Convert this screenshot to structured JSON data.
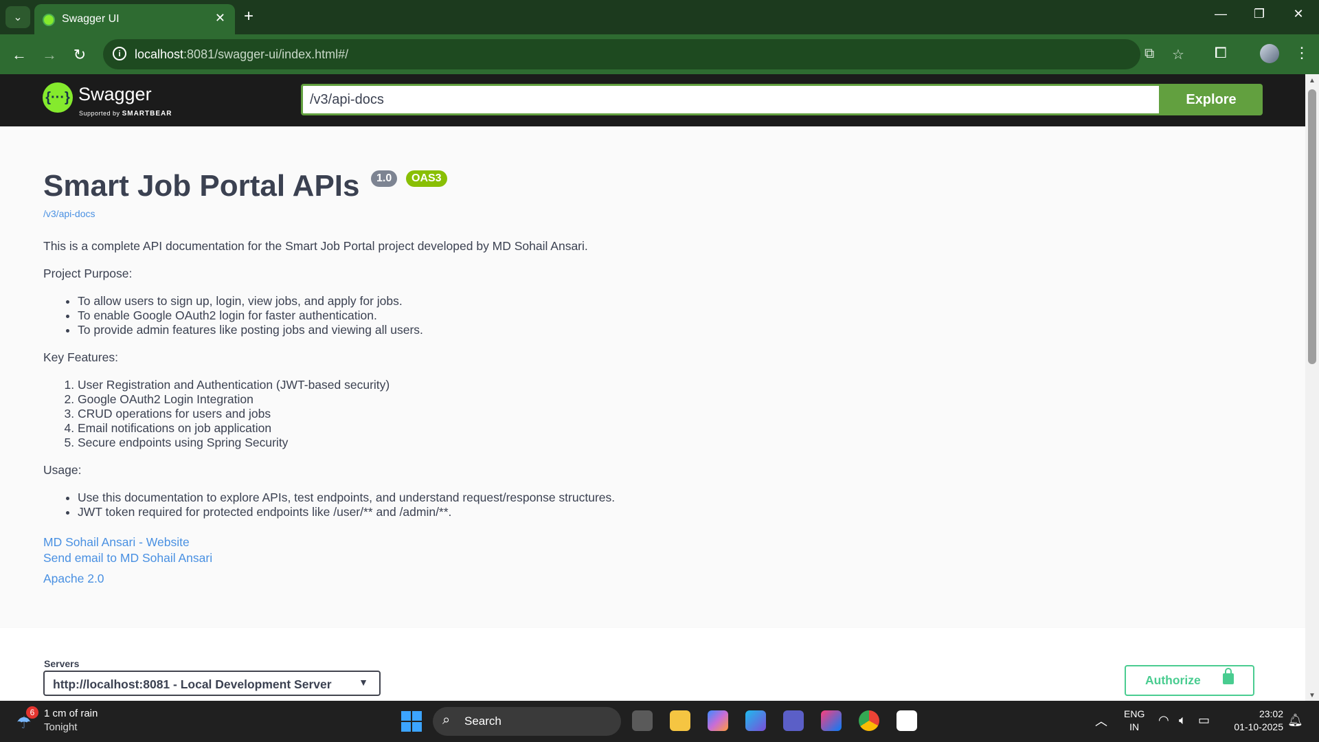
{
  "browser": {
    "tab_title": "Swagger UI",
    "url_host": "localhost",
    "url_rest": ":8081/swagger-ui/index.html#/"
  },
  "swagger": {
    "logo_text": "Swagger",
    "logo_sub_prefix": "Supported by",
    "logo_sub_brand": "SMARTBEAR",
    "spec_url": "/v3/api-docs",
    "explore_label": "Explore"
  },
  "info": {
    "title": "Smart Job Portal APIs",
    "version": "1.0",
    "oas": "OAS3",
    "docs_link": "/v3/api-docs",
    "intro": "This is a complete API documentation for the Smart Job Portal project developed by MD Sohail Ansari.",
    "purpose_heading": "Project Purpose:",
    "purpose_items": [
      "To allow users to sign up, login, view jobs, and apply for jobs.",
      "To enable Google OAuth2 login for faster authentication.",
      "To provide admin features like posting jobs and viewing all users."
    ],
    "features_heading": "Key Features:",
    "features_items": [
      "User Registration and Authentication (JWT-based security)",
      "Google OAuth2 Login Integration",
      "CRUD operations for users and jobs",
      "Email notifications on job application",
      "Secure endpoints using Spring Security"
    ],
    "usage_heading": "Usage:",
    "usage_items": [
      "Use this documentation to explore APIs, test endpoints, and understand request/response structures.",
      "JWT token required for protected endpoints like /user/** and /admin/**."
    ],
    "website_link": "MD Sohail Ansari - Website",
    "email_link": "Send email to MD Sohail Ansari",
    "license_link": "Apache 2.0"
  },
  "servers": {
    "label": "Servers",
    "selected": "http://localhost:8081 - Local Development Server",
    "authorize_label": "Authorize"
  },
  "taskbar": {
    "weather_badge": "6",
    "weather_main": "1 cm of rain",
    "weather_sub": "Tonight",
    "search_label": "Search",
    "lang_top": "ENG",
    "lang_bottom": "IN",
    "time": "23:02",
    "date": "01-10-2025"
  }
}
